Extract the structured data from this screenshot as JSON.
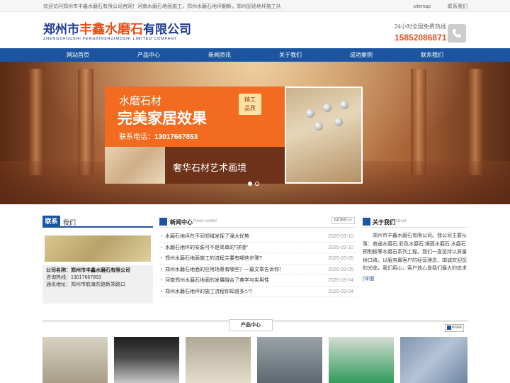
{
  "topbar": {
    "welcome": "欢迎访问郑州市丰鑫水磨石有限公司官网！河南水磨石地面施工，郑州水磨石地坪翻新，郑州固话地坪施工队",
    "sitemap": "sitemap",
    "contact": "联系我们"
  },
  "header": {
    "logo_prefix": "郑州市",
    "logo_highlight": "丰鑫水磨石",
    "logo_suffix": "有限公司",
    "logo_en": "ZHENGZHOUSHI FENGXINSHUIMOSHI LIMITED COMPANY",
    "hotline_label": "24小时全国免费热线",
    "hotline_number": "15852086871",
    "phone_icon": "phone-icon"
  },
  "nav": {
    "items": [
      "网站首页",
      "产品中心",
      "新闻资讯",
      "关于我们",
      "成功案例",
      "联系我们"
    ]
  },
  "banner": {
    "line1": "水磨石材",
    "line2": "完美家居效果",
    "phone_label": "联系电话：",
    "phone_value": "13017667853",
    "badge_line1": "精工",
    "badge_line2": "品质",
    "slogan": "奢华石材艺术画境"
  },
  "contact_box": {
    "tab": "联系",
    "title": "我们",
    "company_label": "公司名称：",
    "company": "郑州市丰鑫水磨石有限公司",
    "phone_label": "咨询热线：",
    "phone": "13017667853",
    "address_label": "通讯地址：",
    "address": "郑州市航海东路新郑路口"
  },
  "news": {
    "title": "新闻中心",
    "subtitle": "News center",
    "more": "MORE>>",
    "items": [
      {
        "title": "水磨石地坪在不同领域发挥了强大优势",
        "date": "2025-03-10"
      },
      {
        "title": "水磨石地坪的安装可不是简单的\"拼接\"",
        "date": "2025-03-10"
      },
      {
        "title": "郑州水磨石地面施工的流程主要有哪些步骤?",
        "date": "2025-03-05"
      },
      {
        "title": "郑州水磨石地面的应用场景有哪些？一篇文章告诉你！",
        "date": "2025-03-05"
      },
      {
        "title": "河南郑州水磨石地面的发展融合了美学与实用性",
        "date": "2025-03-04"
      },
      {
        "title": "郑州水磨石地坪的施工流程你知道多少?",
        "date": "2025-03-04"
      }
    ]
  },
  "about": {
    "title": "关于我们",
    "subtitle": "About",
    "text": "郑州市丰鑫水磨石有限公司。我公司主要从事：普通水磨石;彩色水磨石;镜面水磨石;水磨石预制板等水磨石系列工程。我们一直坚持以质量树口碑，以服务赢客户的经营理念，竭诚欢迎您的光临，我们用心，客户放心是我们最大的追求",
    "detail": "[详细"
  },
  "products": {
    "title": "产品中心",
    "more": "MORE"
  }
}
